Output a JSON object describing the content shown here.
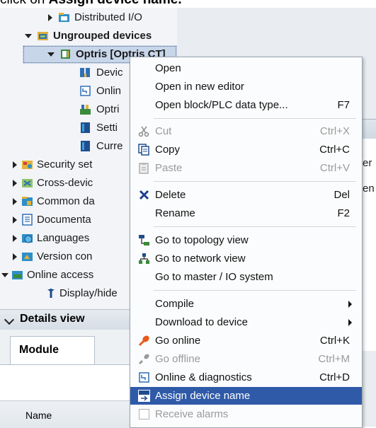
{
  "caption": {
    "prefix": "click on ",
    "bold": "Assign device name."
  },
  "tree": {
    "items": [
      {
        "label": "Distributed I/O",
        "icon": "folder-icon"
      },
      {
        "label": "Ungrouped devices",
        "icon": "device-group-icon"
      },
      {
        "label": "Optris [Optris CT]",
        "icon": "device-icon"
      },
      {
        "label": "Devic",
        "icon": "device-config-icon"
      },
      {
        "label": "Onlin",
        "icon": "online-diagnostics-icon"
      },
      {
        "label": "Optri",
        "icon": "module-icon"
      },
      {
        "label": "Setti",
        "icon": "settings-icon"
      },
      {
        "label": "Curre",
        "icon": "current-icon"
      },
      {
        "label": "Security set",
        "icon": "security-icon"
      },
      {
        "label": "Cross-devic",
        "icon": "cross-device-icon"
      },
      {
        "label": "Common da",
        "icon": "common-data-icon"
      },
      {
        "label": "Documenta",
        "icon": "documentation-icon"
      },
      {
        "label": "Languages",
        "icon": "languages-icon"
      },
      {
        "label": "Version con",
        "icon": "version-control-icon"
      },
      {
        "label": "Online access",
        "icon": "online-access-icon"
      },
      {
        "label": "Display/hide",
        "icon": "display-hide-icon"
      }
    ]
  },
  "right": {
    "col_text_1": "er",
    "col_text_2": "en"
  },
  "details": {
    "title": "Details view",
    "tab": "Module",
    "column": "Name"
  },
  "menu": {
    "items": [
      {
        "label": "Open",
        "shortcut": ""
      },
      {
        "label": "Open in new editor",
        "shortcut": ""
      },
      {
        "label": "Open block/PLC data type...",
        "shortcut": "F7"
      },
      {
        "label": "Cut",
        "shortcut": "Ctrl+X",
        "icon": "scissors-icon"
      },
      {
        "label": "Copy",
        "shortcut": "Ctrl+C",
        "icon": "copy-icon"
      },
      {
        "label": "Paste",
        "shortcut": "Ctrl+V",
        "icon": "paste-icon"
      },
      {
        "label": "Delete",
        "shortcut": "Del",
        "icon": "delete-icon"
      },
      {
        "label": "Rename",
        "shortcut": "F2"
      },
      {
        "label": "Go to topology view",
        "shortcut": "",
        "icon": "topology-icon"
      },
      {
        "label": "Go to network view",
        "shortcut": "",
        "icon": "network-icon"
      },
      {
        "label": "Go to master / IO system",
        "shortcut": ""
      },
      {
        "label": "Compile",
        "shortcut": ""
      },
      {
        "label": "Download to device",
        "shortcut": ""
      },
      {
        "label": "Go online",
        "shortcut": "Ctrl+K",
        "icon": "go-online-icon"
      },
      {
        "label": "Go offline",
        "shortcut": "Ctrl+M",
        "icon": "go-offline-icon"
      },
      {
        "label": "Online & diagnostics",
        "shortcut": "Ctrl+D",
        "icon": "online-diagnostics-icon"
      },
      {
        "label": "Assign device name",
        "shortcut": "",
        "icon": "assign-name-icon"
      },
      {
        "label": "Receive alarms",
        "shortcut": ""
      }
    ]
  }
}
